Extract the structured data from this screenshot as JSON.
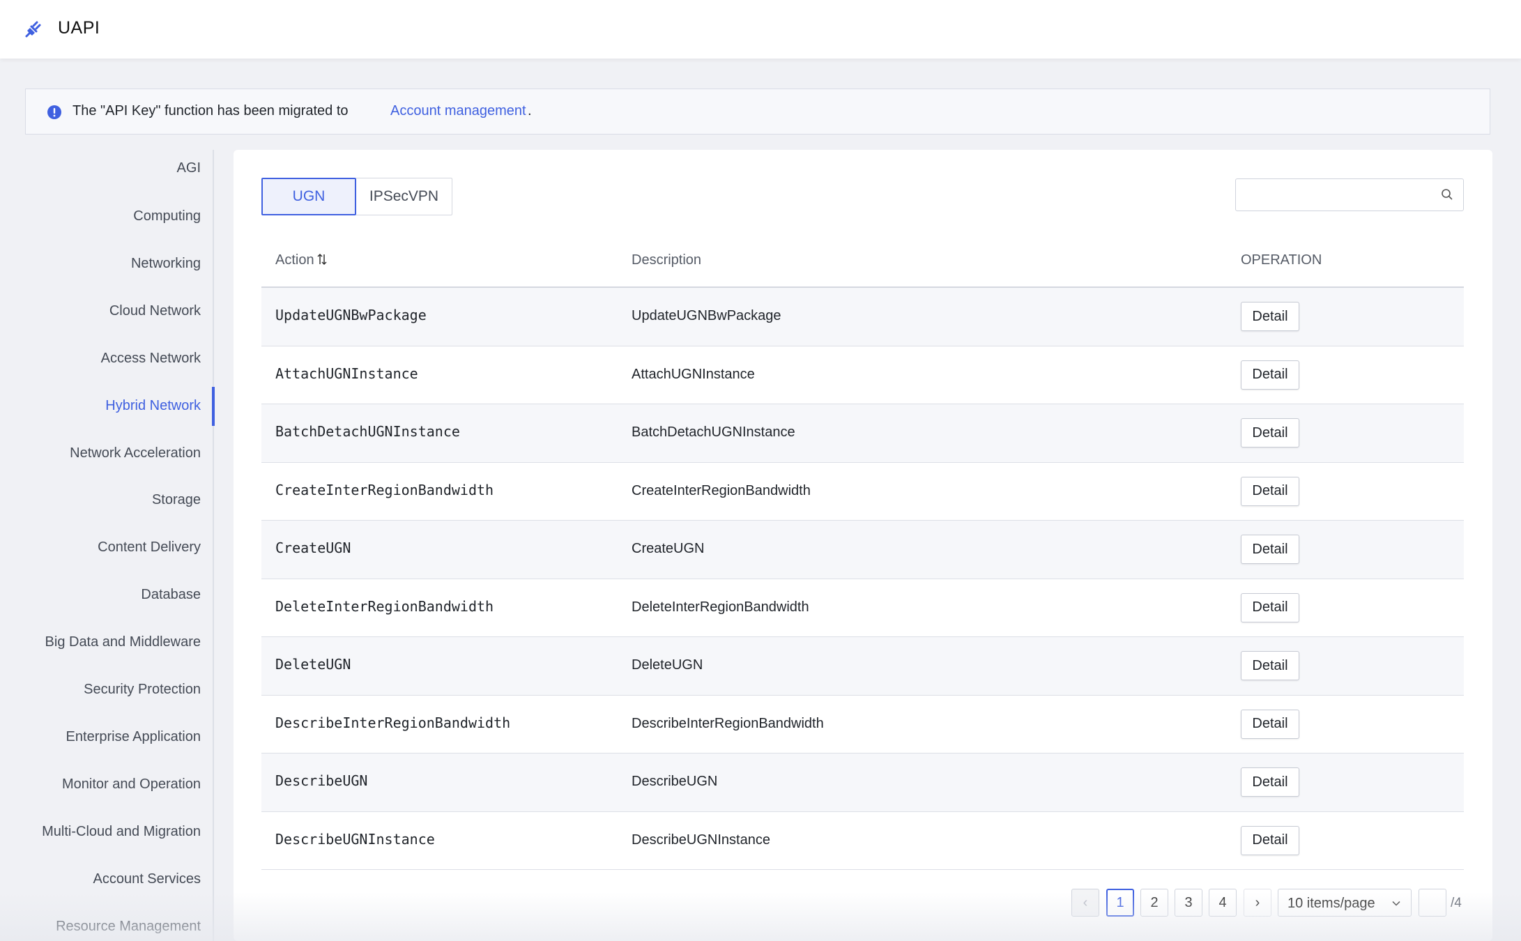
{
  "app": {
    "title": "UAPI"
  },
  "notice": {
    "text": "The \"API Key\" function has been migrated to",
    "link": "Account management",
    "suffix": "."
  },
  "sidebar": {
    "items": [
      {
        "label": "AGI"
      },
      {
        "label": "Computing"
      },
      {
        "label": "Networking"
      },
      {
        "label": "Cloud Network"
      },
      {
        "label": "Access Network"
      },
      {
        "label": "Hybrid Network",
        "active": true
      },
      {
        "label": "Network Acceleration"
      },
      {
        "label": "Storage"
      },
      {
        "label": "Content Delivery"
      },
      {
        "label": "Database"
      },
      {
        "label": "Big Data and Middleware"
      },
      {
        "label": "Security Protection"
      },
      {
        "label": "Enterprise Application"
      },
      {
        "label": "Monitor and Operation"
      },
      {
        "label": "Multi-Cloud and Migration"
      },
      {
        "label": "Account Services"
      },
      {
        "label": "Resource Management"
      }
    ]
  },
  "tabs": [
    {
      "label": "UGN",
      "selected": true
    },
    {
      "label": "IPSecVPN",
      "selected": false
    }
  ],
  "search": {
    "value": "",
    "placeholder": ""
  },
  "table": {
    "headers": {
      "action": "Action",
      "description": "Description",
      "operation": "OPERATION"
    },
    "rows": [
      {
        "action": "UpdateUGNBwPackage",
        "description": "UpdateUGNBwPackage",
        "button": "Detail"
      },
      {
        "action": "AttachUGNInstance",
        "description": "AttachUGNInstance",
        "button": "Detail"
      },
      {
        "action": "BatchDetachUGNInstance",
        "description": "BatchDetachUGNInstance",
        "button": "Detail"
      },
      {
        "action": "CreateInterRegionBandwidth",
        "description": "CreateInterRegionBandwidth",
        "button": "Detail"
      },
      {
        "action": "CreateUGN",
        "description": "CreateUGN",
        "button": "Detail"
      },
      {
        "action": "DeleteInterRegionBandwidth",
        "description": "DeleteInterRegionBandwidth",
        "button": "Detail"
      },
      {
        "action": "DeleteUGN",
        "description": "DeleteUGN",
        "button": "Detail"
      },
      {
        "action": "DescribeInterRegionBandwidth",
        "description": "DescribeInterRegionBandwidth",
        "button": "Detail"
      },
      {
        "action": "DescribeUGN",
        "description": "DescribeUGN",
        "button": "Detail"
      },
      {
        "action": "DescribeUGNInstance",
        "description": "DescribeUGNInstance",
        "button": "Detail"
      }
    ]
  },
  "pagination": {
    "prev": "‹",
    "pages": [
      "1",
      "2",
      "3",
      "4"
    ],
    "current": "1",
    "next": "›",
    "page_size": "10 items/page",
    "jump_value": "",
    "total": "/4"
  },
  "colors": {
    "accent": "#3f60e0",
    "background": "#f0f1f5"
  }
}
